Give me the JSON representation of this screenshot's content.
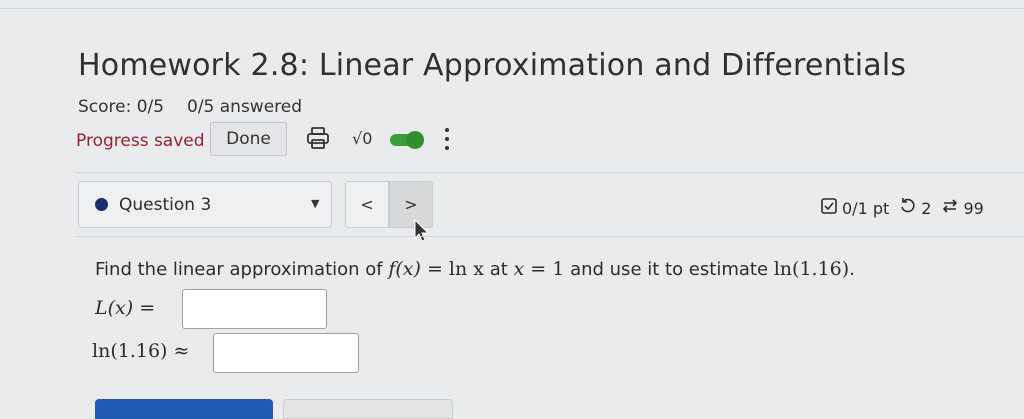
{
  "header": {
    "title": "Homework 2.8: Linear Approximation and Differentials",
    "score": "Score: 0/5",
    "answered": "0/5 answered",
    "progress_status": "Progress saved",
    "done_label": "Done",
    "sqrt_label": "√0",
    "toggle_on": true
  },
  "question_nav": {
    "selected_question": "Question 3",
    "prev_label": "<",
    "next_label": ">"
  },
  "question_meta": {
    "points": "0/1 pt",
    "retries": "2",
    "attempts": "99"
  },
  "problem": {
    "prompt_prefix": "Find the linear approximation of ",
    "f_of_x": "f(x)",
    "equals": " = ",
    "function": "ln x",
    "at_word": " at ",
    "x_var": "x",
    "x_value": "1",
    "prompt_suffix": " and use it to estimate ",
    "estimate_expr": "ln(1.16)",
    "period": ".",
    "lx_label": "L(x) =",
    "ln_label": "ln(1.16) ≈",
    "lx_answer": "",
    "ln_answer": ""
  },
  "colors": {
    "accent_green": "#3a9e3a",
    "progress_red": "#9b2130",
    "submit_blue": "#1f5bb5",
    "question_dot": "#1c2b6b"
  }
}
